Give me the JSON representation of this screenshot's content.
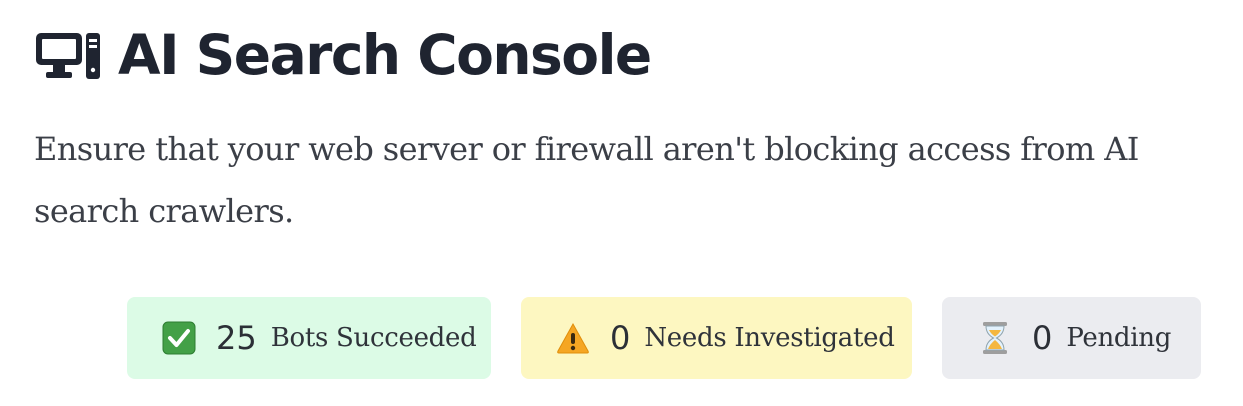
{
  "header": {
    "icon": "desktop-computer-icon",
    "title": "AI Search Console"
  },
  "subtitle": "Ensure that your web server or firewall aren't blocking access from AI search crawlers.",
  "status_cards": [
    {
      "icon": "check-mark-icon",
      "count": "25",
      "label": "Bots Succeeded",
      "color": "#dcfbe6"
    },
    {
      "icon": "warning-icon",
      "count": "0",
      "label": "Needs Investigated",
      "color": "#fdf7c1"
    },
    {
      "icon": "hourglass-icon",
      "count": "0",
      "label": "Pending",
      "color": "#ebecf0"
    }
  ]
}
